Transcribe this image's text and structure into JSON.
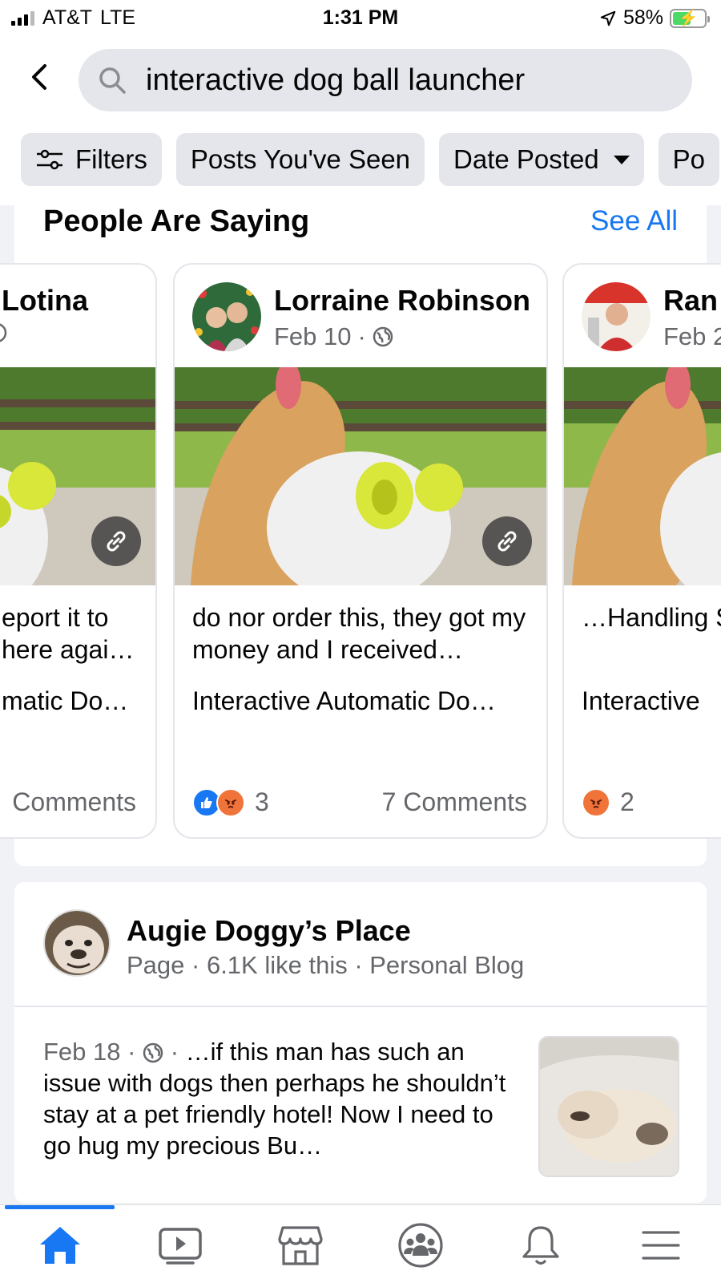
{
  "status_bar": {
    "carrier": "AT&T",
    "network": "LTE",
    "time": "1:31 PM",
    "battery_percent": "58%",
    "battery_level": 0.58
  },
  "search": {
    "query": "interactive dog ball launcher"
  },
  "filters": {
    "chips": [
      {
        "label": "Filters",
        "icon": "sliders-icon"
      },
      {
        "label": "Posts You've Seen"
      },
      {
        "label": "Date Posted",
        "icon": "caret-down-icon"
      },
      {
        "label": "Po"
      }
    ]
  },
  "people_saying": {
    "title": "People Are Saying",
    "see_all": "See All",
    "cards": [
      {
        "author": "Lotina",
        "date": "",
        "excerpt": "eport it to here agai…",
        "product": "matic Do…",
        "reaction_count": "",
        "comments": "Comments"
      },
      {
        "author": "Lorraine Robinson",
        "date": "Feb 10",
        "excerpt": "do nor order this, they got my money and I received…",
        "product": "Interactive Automatic Do…",
        "reaction_count": "3",
        "comments": "7 Comments"
      },
      {
        "author": "Ran",
        "date": "Feb 2",
        "excerpt": "…Handling Ship within",
        "product": "Interactive",
        "reaction_count": "2",
        "comments": ""
      }
    ]
  },
  "result": {
    "page_name": "Augie Doggy’s Place",
    "page_meta": "Page · 6.1K like this · Personal Blog",
    "post_date": "Feb 18",
    "post_text": "…if this man has such an issue with dogs then perhaps he shouldn’t stay at a pet friendly hotel! Now I need to go hug my precious Bu…"
  },
  "colors": {
    "accent": "#1877f2",
    "secondary_text": "#65676b",
    "chip_bg": "#e4e6eb",
    "angry": "#f0743a"
  },
  "nav": {
    "items": [
      "home-icon",
      "watch-icon",
      "marketplace-icon",
      "groups-icon",
      "notifications-icon",
      "menu-icon"
    ],
    "active": "home-icon"
  }
}
